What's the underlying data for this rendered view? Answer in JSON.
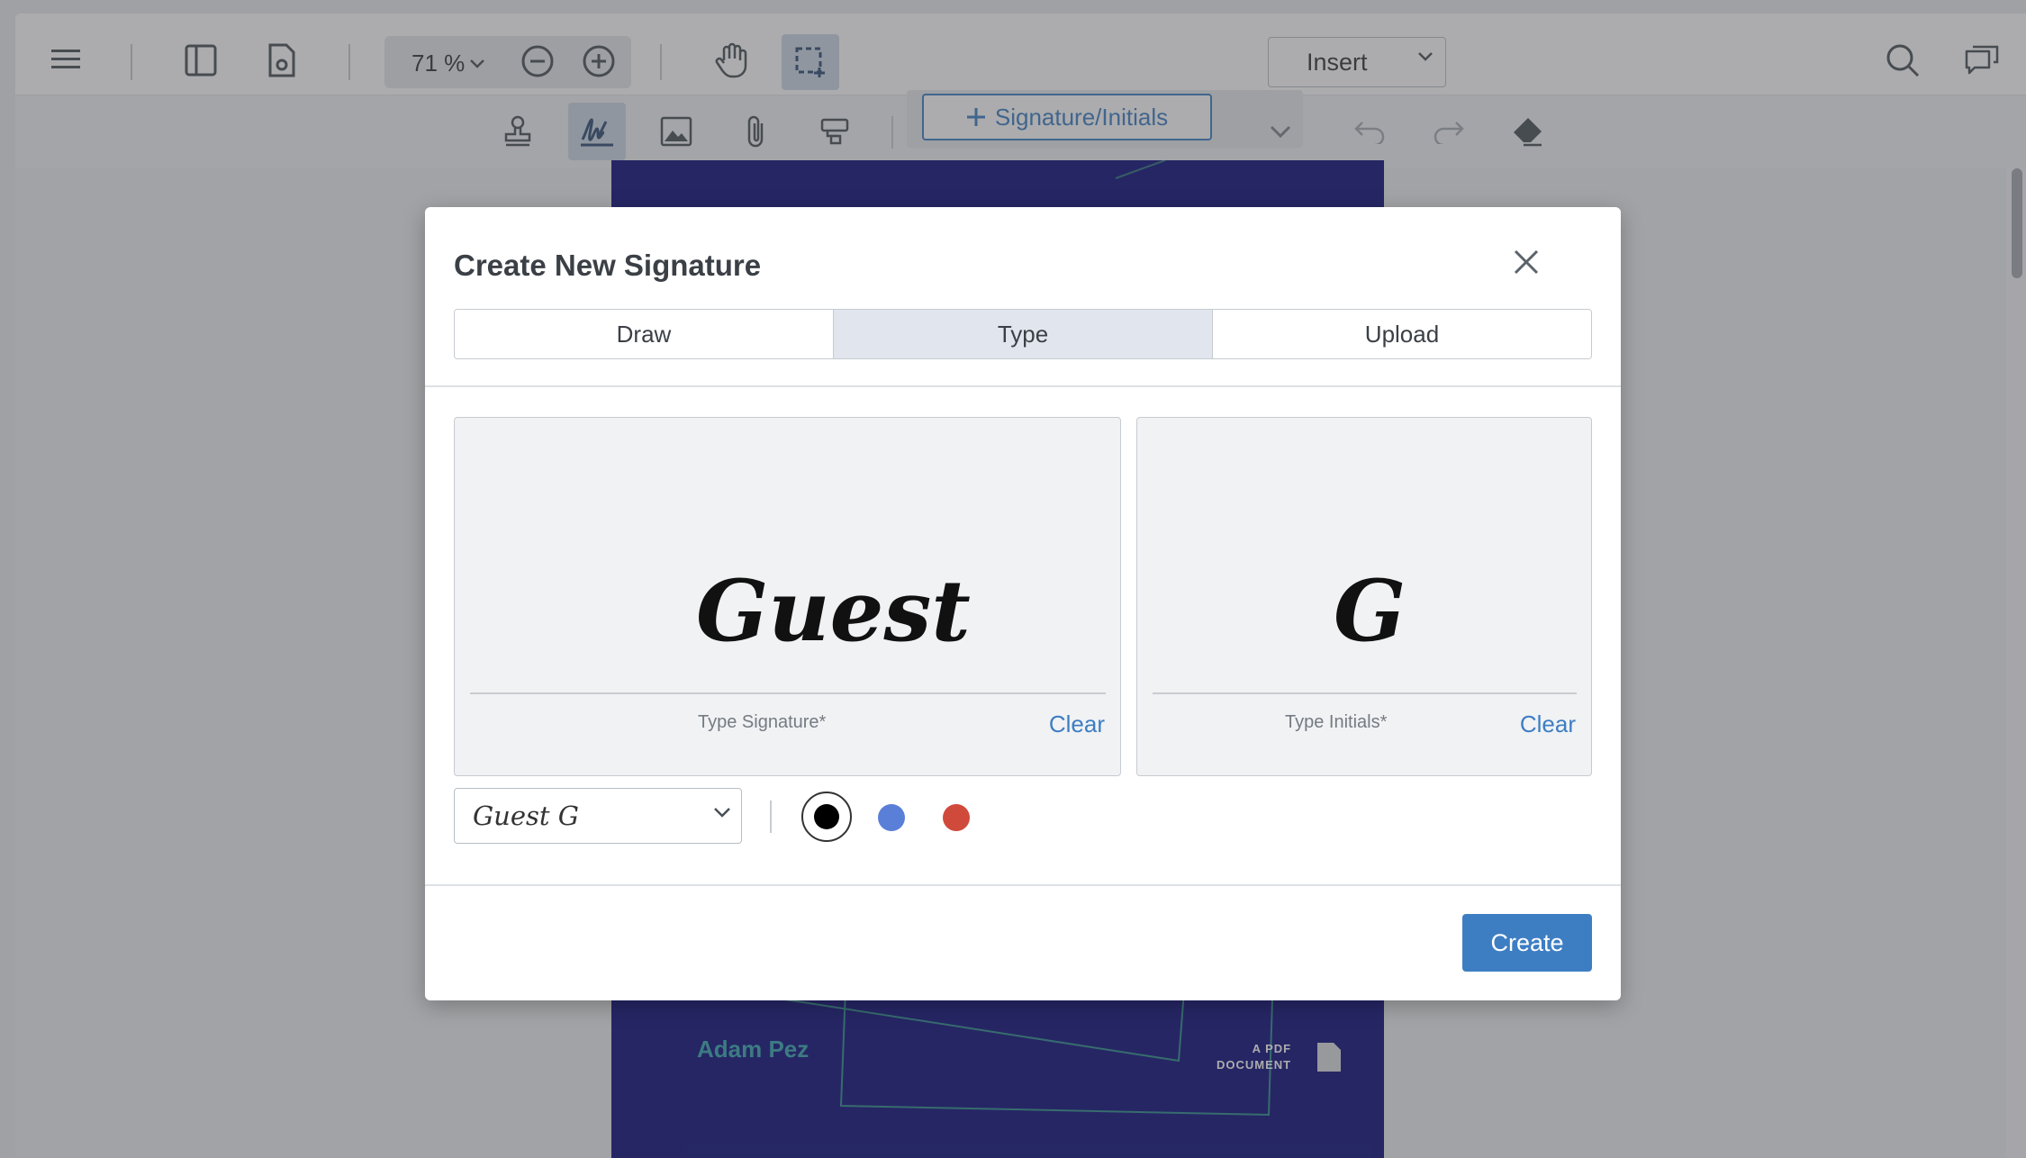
{
  "toolbar": {
    "zoom_value": "71 %",
    "insert_label": "Insert",
    "icons": [
      "menu-icon",
      "sidebar-icon",
      "document-settings-icon",
      "zoom-out-icon",
      "zoom-in-icon",
      "pan-hand-icon",
      "marquee-select-icon",
      "search-icon",
      "comments-icon"
    ]
  },
  "subtoolbar": {
    "signature_button_label": "Signature/Initials",
    "icons": [
      "stamp-icon",
      "signature-icon",
      "image-icon",
      "paperclip-icon",
      "form-field-icon",
      "undo-icon",
      "redo-icon",
      "eraser-icon"
    ]
  },
  "document": {
    "author": "Adam Pez",
    "badge_line1": "A PDF",
    "badge_line2": "DOCUMENT",
    "page_color": "#0b0b7a"
  },
  "modal": {
    "title": "Create New Signature",
    "tabs": [
      {
        "label": "Draw",
        "active": false
      },
      {
        "label": "Type",
        "active": true
      },
      {
        "label": "Upload",
        "active": false
      }
    ],
    "signature": {
      "value": "Guest",
      "hint": "Type Signature*",
      "clear_label": "Clear"
    },
    "initials": {
      "value": "G",
      "hint": "Type Initials*",
      "clear_label": "Clear"
    },
    "font_select": {
      "selected": "Guest G"
    },
    "colors": [
      {
        "name": "black",
        "hex": "#000000",
        "selected": true
      },
      {
        "name": "blue",
        "hex": "#5a7fd8",
        "selected": false
      },
      {
        "name": "red",
        "hex": "#d04a3c",
        "selected": false
      }
    ],
    "create_label": "Create"
  },
  "accent_color": "#3d7ec3"
}
